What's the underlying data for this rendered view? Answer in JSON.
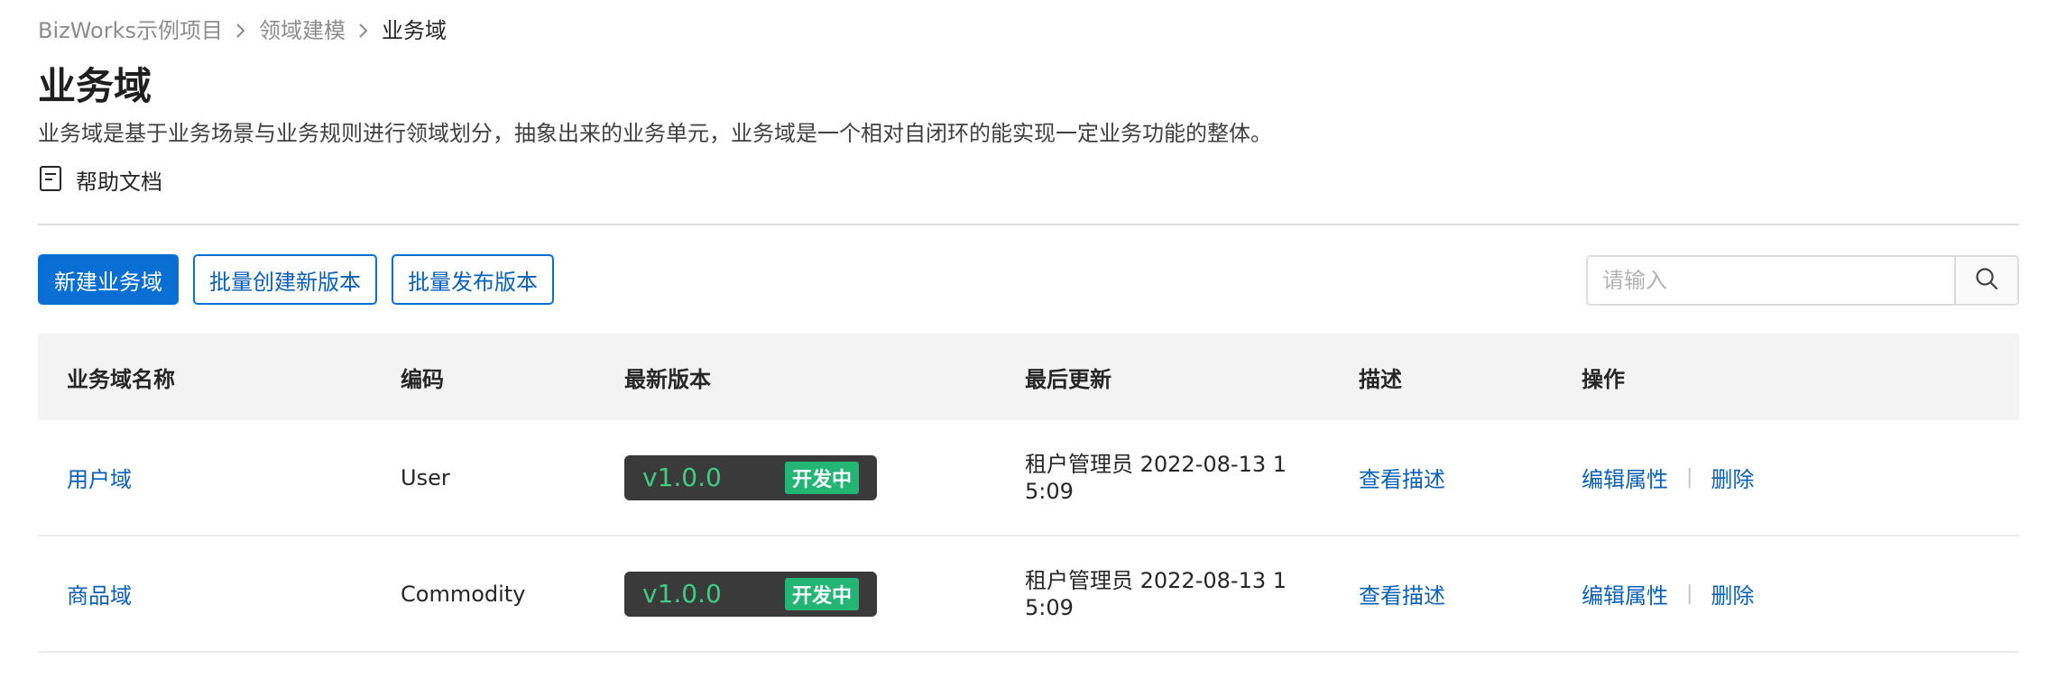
{
  "breadcrumb": [
    "BizWorks示例项目",
    "领域建模",
    "业务域"
  ],
  "page": {
    "title": "业务域",
    "description": "业务域是基于业务场景与业务规则进行领域划分，抽象出来的业务单元，业务域是一个相对自闭环的能实现一定业务功能的整体。",
    "help_label": "帮助文档"
  },
  "toolbar": {
    "new_label": "新建业务域",
    "batch_create_label": "批量创建新版本",
    "batch_publish_label": "批量发布版本"
  },
  "search": {
    "placeholder": "请输入",
    "value": ""
  },
  "table": {
    "columns": [
      "业务域名称",
      "编码",
      "最新版本",
      "最后更新",
      "描述",
      "操作"
    ],
    "rows": [
      {
        "name": "用户域",
        "code": "User",
        "version": "v1.0.0",
        "status": "开发中",
        "updated": "租户管理员 2022-08-13 15:09",
        "desc_link": "查看描述",
        "edit_label": "编辑属性",
        "delete_label": "删除"
      },
      {
        "name": "商品域",
        "code": "Commodity",
        "version": "v1.0.0",
        "status": "开发中",
        "updated": "租户管理员 2022-08-13 15:09",
        "desc_link": "查看描述",
        "edit_label": "编辑属性",
        "delete_label": "删除"
      }
    ]
  },
  "colors": {
    "primary": "#0a6fd4",
    "link": "#0a5fb8",
    "version_green": "#3dcc82",
    "status_green": "#22b573"
  },
  "icons": {
    "chevron": "chevron-right-icon",
    "help": "document-icon",
    "search": "search-icon"
  }
}
